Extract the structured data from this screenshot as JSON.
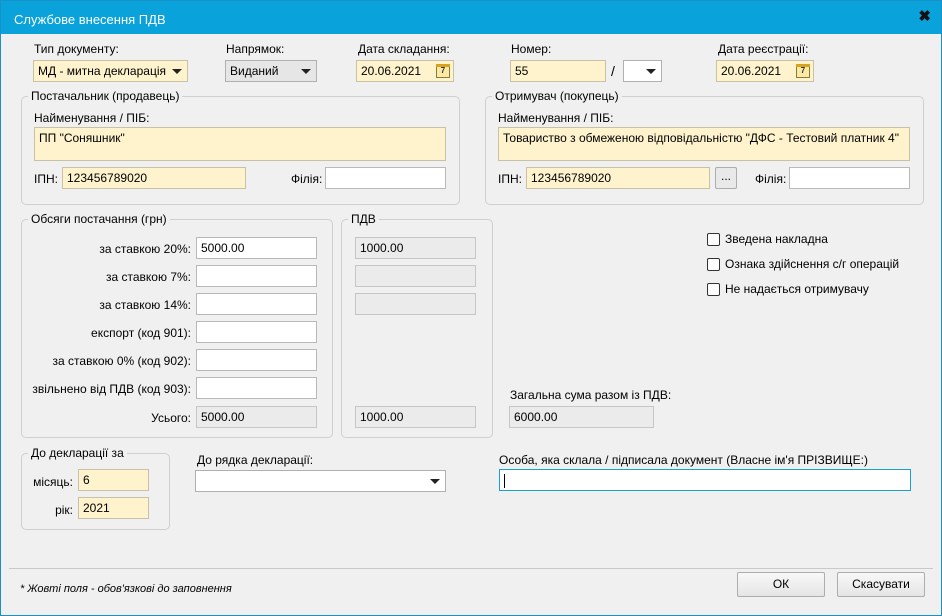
{
  "window": {
    "title": "Службове внесення ПДВ",
    "close_glyph": "✖"
  },
  "top": {
    "doc_type": {
      "label": "Тип документу:",
      "value": "МД - митна декларація"
    },
    "direction": {
      "label": "Напрямок:",
      "value": "Виданий"
    },
    "date_compiled": {
      "label": "Дата складання:",
      "value": "20.06.2021",
      "icon": "calendar-icon"
    },
    "number": {
      "label": "Номер:",
      "value": "55",
      "separator": "/",
      "suffix": ""
    },
    "date_registered": {
      "label": "Дата реєстрації:",
      "value": "20.06.2021",
      "icon": "calendar-icon"
    }
  },
  "supplier": {
    "legend": "Постачальник (продавець)",
    "name_label": "Найменування / ПІБ:",
    "name_value": "ПП \"Соняшник\"",
    "inn_label": "ІПН:",
    "inn_value": "123456789020",
    "branch_label": "Філія:",
    "branch_value": ""
  },
  "recipient": {
    "legend": "Отримувач (покупець)",
    "name_label": "Найменування / ПІБ:",
    "name_value": "Товариство з обмеженою відповідальністю \"ДФС - Тестовий платник 4\"",
    "inn_label": "ІПН:",
    "inn_value": "123456789020",
    "lookup_label": "...",
    "branch_label": "Філія:",
    "branch_value": ""
  },
  "volumes": {
    "legend": "Обсяги постачання (грн)",
    "rows": [
      {
        "label": "за ставкою 20%:",
        "value": "5000.00",
        "vat": "1000.00"
      },
      {
        "label": "за ставкою 7%:",
        "value": "",
        "vat": ""
      },
      {
        "label": "за ставкою 14%:",
        "value": "",
        "vat": ""
      },
      {
        "label": "експорт (код 901):",
        "value": ""
      },
      {
        "label": "за ставкою 0% (код 902):",
        "value": ""
      },
      {
        "label": "звільнено від ПДВ (код 903):",
        "value": ""
      }
    ],
    "total_label": "Усього:",
    "total_value": "5000.00"
  },
  "vat": {
    "legend": "ПДВ",
    "total_value": "1000.00"
  },
  "flags": [
    {
      "label": "Зведена накладна",
      "checked": false
    },
    {
      "label": "Ознака здійснення с/г операцій",
      "checked": false
    },
    {
      "label": "Не надається отримувачу",
      "checked": false
    }
  ],
  "grand_total": {
    "label": "Загальна сума разом із ПДВ:",
    "value": "6000.00"
  },
  "declaration": {
    "legend": "До декларації за",
    "month_label": "місяць:",
    "month_value": "6",
    "year_label": "рік:",
    "year_value": "2021"
  },
  "declaration_row": {
    "label": "До рядка декларації:",
    "value": ""
  },
  "signer": {
    "label": "Особа, яка склала / підписала документ (Власне ім'я ПРІЗВИЩЕ:)",
    "value": ""
  },
  "footer": {
    "note": "* Жовті поля - обов'язкові до заповнення",
    "ok_label": "ОК",
    "cancel_label": "Скасувати"
  }
}
